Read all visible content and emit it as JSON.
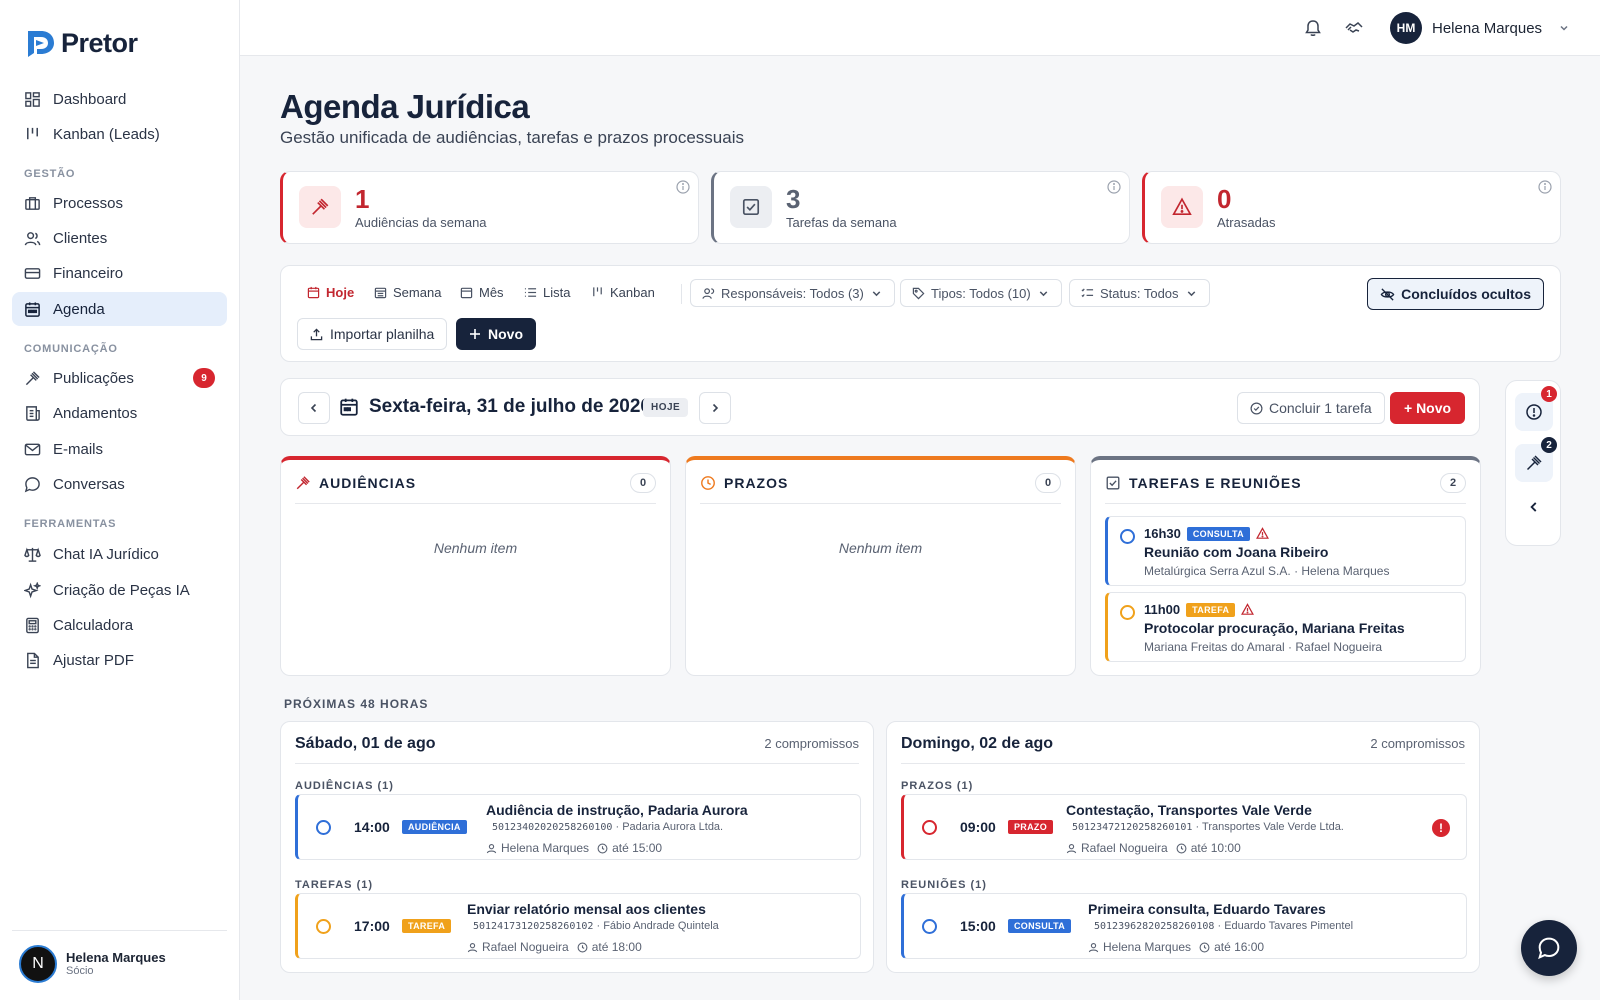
{
  "brand": {
    "name": "Pretor"
  },
  "sidebar": {
    "items": [
      {
        "label": "Dashboard",
        "icon": "dashboard-icon"
      },
      {
        "label": "Kanban (Leads)",
        "icon": "kanban-icon"
      },
      {
        "label": "Processos",
        "icon": "briefcase-icon"
      },
      {
        "label": "Clientes",
        "icon": "users-icon"
      },
      {
        "label": "Financeiro",
        "icon": "credit-card-icon"
      },
      {
        "label": "Agenda",
        "icon": "calendar-icon"
      },
      {
        "label": "Publicações",
        "icon": "gavel-icon",
        "badge": "9"
      },
      {
        "label": "Andamentos",
        "icon": "newspaper-icon"
      },
      {
        "label": "E-mails",
        "icon": "mail-icon"
      },
      {
        "label": "Conversas",
        "icon": "chat-icon"
      },
      {
        "label": "Chat IA Jurídico",
        "icon": "scale-icon"
      },
      {
        "label": "Criação de Peças IA",
        "icon": "sparkles-icon"
      },
      {
        "label": "Calculadora",
        "icon": "calculator-icon"
      },
      {
        "label": "Ajustar PDF",
        "icon": "file-icon"
      }
    ],
    "sections": {
      "gestao": "GESTÃO",
      "comunicacao": "COMUNICAÇÃO",
      "ferramentas": "FERRAMENTAS"
    },
    "user": {
      "initial": "N",
      "name": "Helena Marques",
      "role": "Sócio"
    },
    "active": "Agenda"
  },
  "topbar": {
    "user_initials": "HM",
    "user_name": "Helena Marques"
  },
  "page": {
    "title": "Agenda Jurídica",
    "subtitle": "Gestão unificada de audiências, tarefas e prazos processuais"
  },
  "stats": [
    {
      "value": "1",
      "label": "Audiências da semana",
      "color": "#c2262f"
    },
    {
      "value": "3",
      "label": "Tarefas da semana",
      "color": "#5a6272"
    },
    {
      "value": "0",
      "label": "Atrasadas",
      "color": "#c2262f"
    }
  ],
  "toolbar": {
    "views": [
      "Hoje",
      "Semana",
      "Mês",
      "Lista",
      "Kanban"
    ],
    "active_view": "Hoje",
    "filters": {
      "responsaveis": "Responsáveis: Todos (3)",
      "tipos": "Tipos: Todos (10)",
      "status": "Status: Todos"
    },
    "concluidos": "Concluídos ocultos",
    "import": "Importar planilha",
    "novo": "Novo"
  },
  "day": {
    "title": "Sexta-feira, 31 de julho de 2026",
    "today_badge": "HOJE",
    "concluir": "Concluir 1 tarefa",
    "novo": "+ Novo"
  },
  "rail": {
    "alerts_badge": "1",
    "hearings_badge": "2"
  },
  "columns": [
    {
      "title": "AUDIÊNCIAS",
      "count": "0",
      "empty": "Nenhum item",
      "color": "#d7262f"
    },
    {
      "title": "PRAZOS",
      "count": "0",
      "empty": "Nenhum item",
      "color": "#ee7a1f"
    },
    {
      "title": "TAREFAS E REUNIÕES",
      "count": "2",
      "color": "#6b7383",
      "items": [
        {
          "time": "16h30",
          "tag": "CONSULTA",
          "title": "Reunião com Joana Ribeiro",
          "meta": "Metalúrgica Serra Azul S.A. · Helena Marques"
        },
        {
          "time": "11h00",
          "tag": "TAREFA",
          "title": "Protocolar procuração, Mariana Freitas",
          "meta": "Mariana Freitas do Amaral · Rafael Nogueira"
        }
      ]
    }
  ],
  "next48": {
    "label": "PRÓXIMAS 48 HORAS",
    "days": [
      {
        "title": "Sábado, 01 de ago",
        "count": "2 compromissos",
        "groups": [
          {
            "label": "AUDIÊNCIAS (1)",
            "event": {
              "time": "14:00",
              "tag": "AUDIÊNCIA",
              "title": "Audiência de instrução, Padaria Aurora",
              "process": "50123402020258260100",
              "client": "· Padaria Aurora Ltda.",
              "owner": "Helena Marques",
              "until": "até 15:00"
            }
          },
          {
            "label": "TAREFAS (1)",
            "event": {
              "time": "17:00",
              "tag": "TAREFA",
              "title": "Enviar relatório mensal aos clientes",
              "process": "50124173120258260102",
              "client": "· Fábio Andrade Quintela",
              "owner": "Rafael Nogueira",
              "until": "até 18:00"
            }
          }
        ]
      },
      {
        "title": "Domingo, 02 de ago",
        "count": "2 compromissos",
        "groups": [
          {
            "label": "PRAZOS (1)",
            "event": {
              "time": "09:00",
              "tag": "PRAZO",
              "title": "Contestação, Transportes Vale Verde",
              "process": "50123472120258260101",
              "client": "· Transportes Vale Verde Ltda.",
              "owner": "Rafael Nogueira",
              "until": "até 10:00",
              "alert": "!"
            }
          },
          {
            "label": "REUNIÕES (1)",
            "event": {
              "time": "15:00",
              "tag": "CONSULTA",
              "title": "Primeira consulta, Eduardo Tavares",
              "process": "50123962820258260108",
              "client": "· Eduardo Tavares Pimentel",
              "owner": "Helena Marques",
              "until": "até 16:00"
            }
          }
        ]
      }
    ]
  },
  "colors": {
    "navy": "#17233b",
    "red": "#d7262f",
    "orange": "#ee7a1f",
    "blue": "#2f6fd8",
    "amber": "#f0a11b"
  }
}
